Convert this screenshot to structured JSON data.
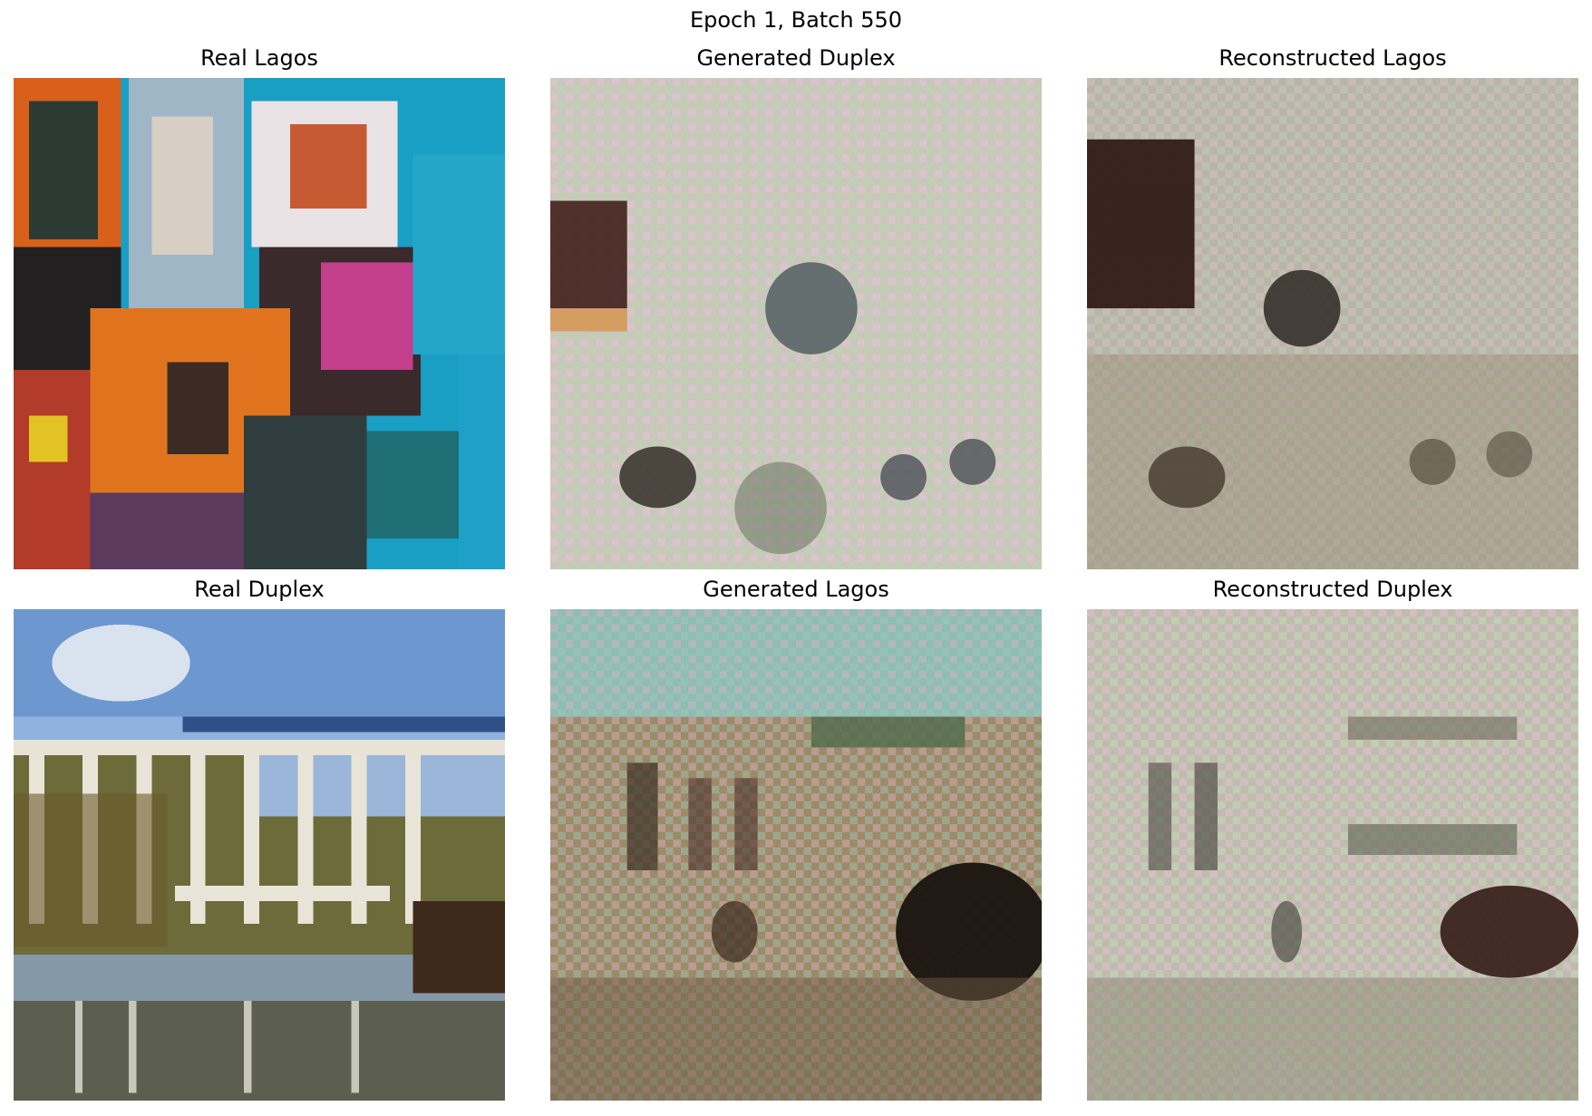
{
  "figure": {
    "title": "Epoch 1, Batch 550"
  },
  "panels": [
    {
      "key": "real_lagos",
      "title": "Real Lagos"
    },
    {
      "key": "generated_duplex",
      "title": "Generated Duplex"
    },
    {
      "key": "reconstructed_lagos",
      "title": "Reconstructed Lagos"
    },
    {
      "key": "real_duplex",
      "title": "Real Duplex"
    },
    {
      "key": "generated_lagos",
      "title": "Generated Lagos"
    },
    {
      "key": "reconstructed_duplex",
      "title": "Reconstructed Duplex"
    }
  ]
}
